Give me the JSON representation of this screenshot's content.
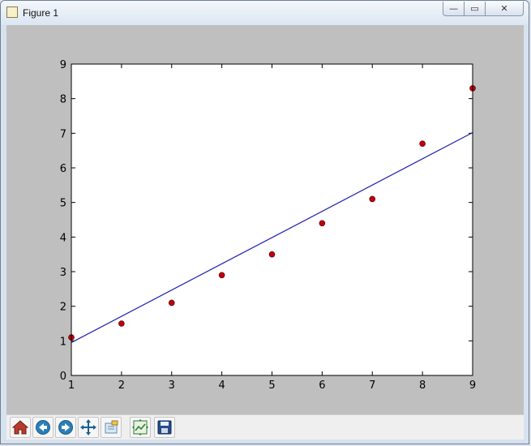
{
  "window": {
    "title": "Figure 1"
  },
  "controls": {
    "minimize": "—",
    "maximize": "▭",
    "close": "✕"
  },
  "toolbar": {
    "buttons": [
      {
        "name": "home-button",
        "icon": "home-icon"
      },
      {
        "name": "back-button",
        "icon": "back-arrow-icon"
      },
      {
        "name": "forward-button",
        "icon": "forward-arrow-icon"
      },
      {
        "name": "pan-button",
        "icon": "pan-arrows-icon"
      },
      {
        "name": "zoom-button",
        "icon": "zoom-rect-icon"
      },
      {
        "name": "subplots-button",
        "icon": "subplots-config-icon"
      },
      {
        "name": "save-button",
        "icon": "save-floppy-icon"
      }
    ]
  },
  "chart_data": {
    "type": "scatter",
    "xlim": [
      1,
      9
    ],
    "ylim": [
      0,
      9
    ],
    "xticks": [
      "1",
      "2",
      "3",
      "4",
      "5",
      "6",
      "7",
      "8",
      "9"
    ],
    "yticks": [
      "0",
      "1",
      "2",
      "3",
      "4",
      "5",
      "6",
      "7",
      "8",
      "9"
    ],
    "grid": false,
    "series": [
      {
        "type": "scatter",
        "color": "#c0000f",
        "points": [
          {
            "x": 1,
            "y": 1.1
          },
          {
            "x": 2,
            "y": 1.5
          },
          {
            "x": 3,
            "y": 2.1
          },
          {
            "x": 4,
            "y": 2.9
          },
          {
            "x": 5,
            "y": 3.5
          },
          {
            "x": 6,
            "y": 4.4
          },
          {
            "x": 7,
            "y": 5.1
          },
          {
            "x": 8,
            "y": 6.7
          },
          {
            "x": 9,
            "y": 8.3
          }
        ]
      },
      {
        "type": "line",
        "color": "#1f1fb0",
        "points": [
          {
            "x": 1,
            "y": 0.95
          },
          {
            "x": 9,
            "y": 7.02
          }
        ]
      }
    ]
  }
}
